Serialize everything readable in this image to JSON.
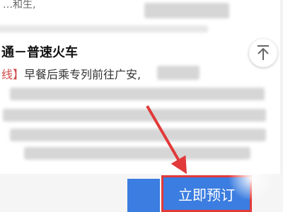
{
  "content": {
    "top_fragment": "…和生,",
    "section_title": "通－普速火车",
    "description_bracket": "线】",
    "description_text": "早餐后乘专列前往广安,"
  },
  "scroll_top_icon": "arrow-up-icon",
  "buy_button": {
    "label": "立即预订"
  },
  "colors": {
    "accent_blue": "#3b7de0",
    "annotation_red": "#e23a3a"
  }
}
